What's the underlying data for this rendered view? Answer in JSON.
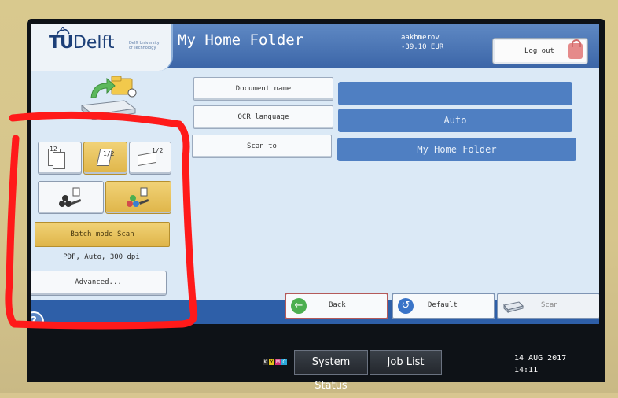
{
  "header": {
    "logo_text_tu": "TU",
    "logo_text_delft": "Delft",
    "logo_subtext": "Delft University of Technology",
    "title": "My Home Folder",
    "user_name": "aakhmerov",
    "balance": "-39.10 EUR",
    "logout_label": "Log out"
  },
  "left_panel": {
    "duplex_options": [
      {
        "icon": "one-sided-original-icon",
        "text": "12"
      },
      {
        "icon": "two-sided-book-icon",
        "text": "1/2"
      },
      {
        "icon": "two-sided-top-icon",
        "text": "1/2"
      }
    ],
    "selected_duplex_index": 1,
    "mode_options": [
      {
        "icon": "single-scan-icon"
      },
      {
        "icon": "batch-scan-icon"
      }
    ],
    "selected_mode_index": 1,
    "batch_mode_label": "Batch mode Scan",
    "settings_summary": "PDF, Auto, 300 dpi",
    "advanced_label": "Advanced..."
  },
  "form": {
    "rows": [
      {
        "label": "Document name",
        "value": ""
      },
      {
        "label": "OCR language",
        "value": "Auto"
      },
      {
        "label": "Scan to",
        "value": "My Home Folder"
      }
    ]
  },
  "footer": {
    "back_label": "Back",
    "default_label": "Default",
    "scan_label": "Scan"
  },
  "system_bar": {
    "kvhc_letters": [
      "K",
      "Y",
      "M",
      "C"
    ],
    "system_status_label": "System Status",
    "job_list_label": "Job List",
    "date": "14 AUG  2017",
    "time": "14:11"
  },
  "colors": {
    "header_blue": "#3c66a8",
    "field_blue": "#4f7fc2",
    "selected_yellow": "#dfb549",
    "annotation_red": "#ff1a1a"
  }
}
